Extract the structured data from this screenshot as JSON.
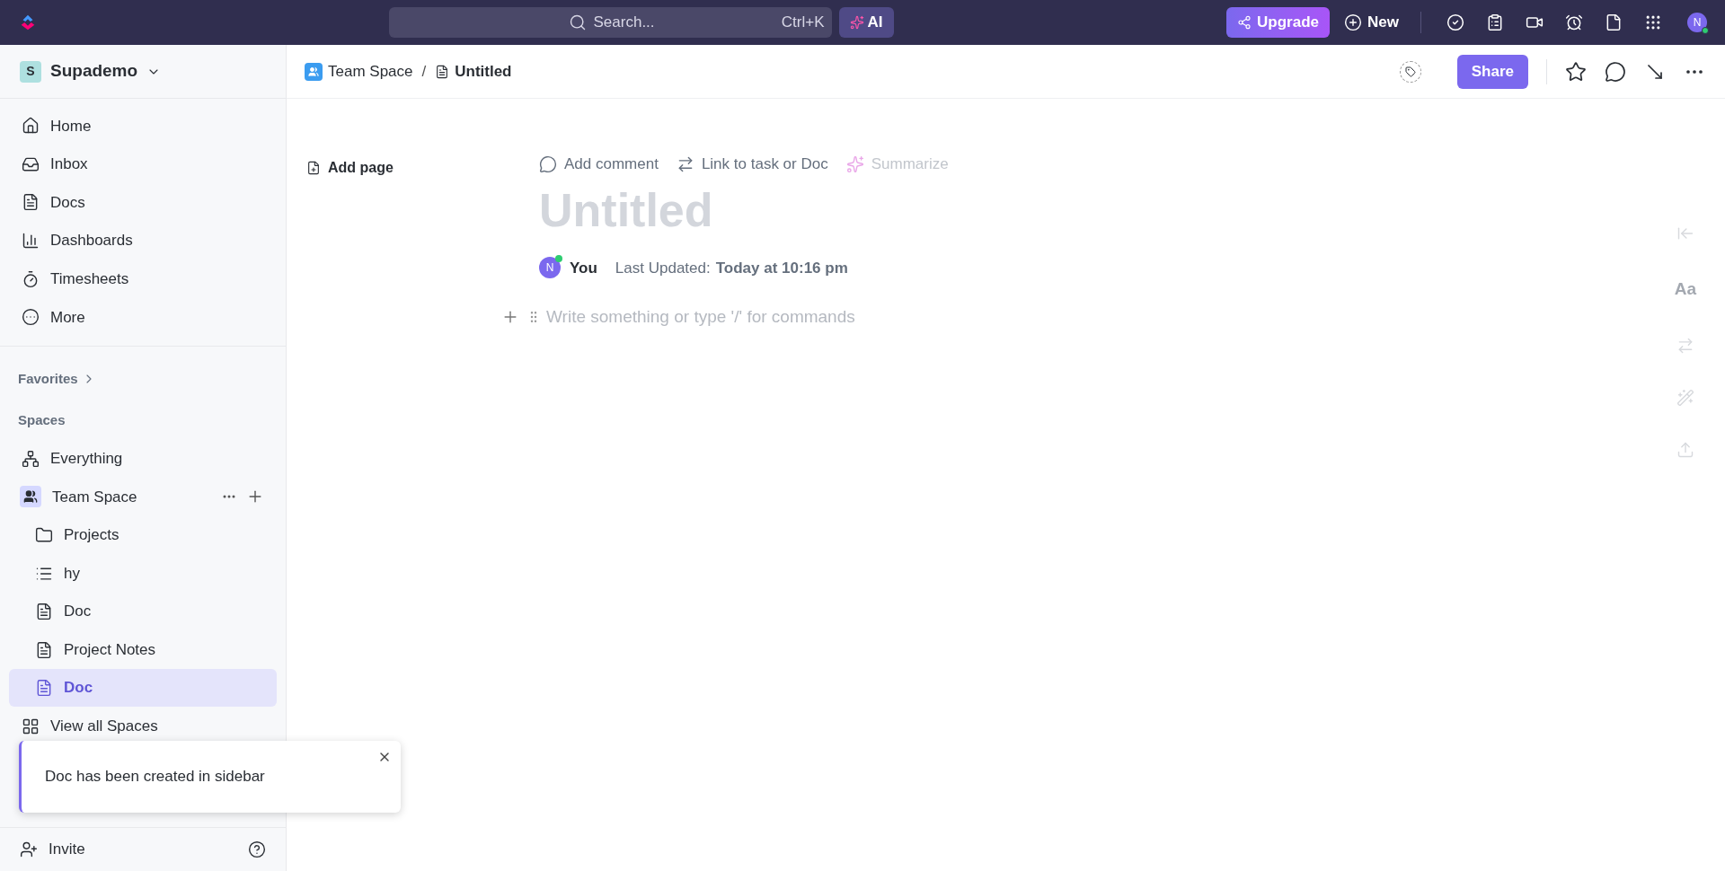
{
  "topbar": {
    "search_placeholder": "Search...",
    "shortcut": "Ctrl+K",
    "ai": "AI",
    "upgrade": "Upgrade",
    "new": "New",
    "avatar": "N"
  },
  "workspace": {
    "initial": "S",
    "name": "Supademo"
  },
  "nav": [
    {
      "label": "Home"
    },
    {
      "label": "Inbox"
    },
    {
      "label": "Docs"
    },
    {
      "label": "Dashboards"
    },
    {
      "label": "Timesheets"
    },
    {
      "label": "More"
    }
  ],
  "favorites": "Favorites",
  "spaces_heading": "Spaces",
  "spaces": [
    {
      "label": "Everything",
      "kind": "everything"
    },
    {
      "label": "Team Space",
      "kind": "space",
      "children": [
        {
          "label": "Projects",
          "kind": "folder",
          "selected": false
        },
        {
          "label": "hy",
          "kind": "list",
          "selected": false
        },
        {
          "label": "Doc",
          "kind": "doc",
          "selected": false
        },
        {
          "label": "Project Notes",
          "kind": "doc",
          "selected": false
        },
        {
          "label": "Doc",
          "kind": "doc",
          "selected": true
        }
      ]
    }
  ],
  "view_all": "View all Spaces",
  "toast": "Doc has been created in sidebar",
  "invite": "Invite",
  "breadcrumb": [
    "Team Space",
    "Untitled"
  ],
  "breadcrumb_separator": "/",
  "share": "Share",
  "add_page": "Add page",
  "actions": [
    {
      "label": "Add comment",
      "disabled": false
    },
    {
      "label": "Link to task or Doc",
      "disabled": false
    },
    {
      "label": "Summarize",
      "disabled": true
    }
  ],
  "doc": {
    "title": "Untitled",
    "avatar": "N",
    "author": "You",
    "updated_label": "Last Updated:",
    "updated_value": "Today at 10:16 pm",
    "placeholder": "Write something or type '/' for commands"
  },
  "format_label": "Aa"
}
